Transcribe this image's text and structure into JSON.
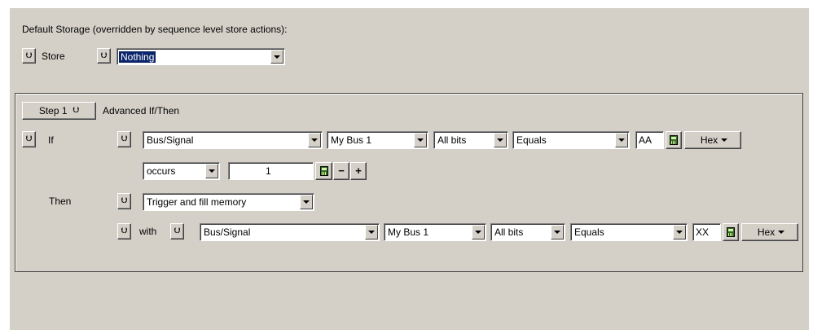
{
  "default_storage": {
    "heading": "Default Storage (overridden by sequence level store actions):",
    "store_label": "Store",
    "store_value": "Nothing"
  },
  "step": {
    "step_label": "Step 1",
    "type_label": "Advanced If/Then"
  },
  "if_row": {
    "label": "If",
    "source": "Bus/Signal",
    "bus": "My Bus 1",
    "bits": "All bits",
    "operator": "Equals",
    "value": "AA",
    "radix": "Hex"
  },
  "occurs_row": {
    "mode": "occurs",
    "count": "1",
    "minus": "−",
    "plus": "+"
  },
  "then_row": {
    "label": "Then",
    "action": "Trigger and fill memory"
  },
  "with_row": {
    "label": "with",
    "source": "Bus/Signal",
    "bus": "My Bus 1",
    "bits": "All bits",
    "operator": "Equals",
    "value": "XX",
    "radix": "Hex"
  },
  "icons": {
    "chevron": "chevron-down-double-icon",
    "calculator": "calculator-icon",
    "dropdown": "dropdown-arrow-icon"
  },
  "colors": {
    "dialog_bg": "#d4d0c8",
    "selection_bg": "#0a246a",
    "selection_fg": "#ffffff"
  }
}
